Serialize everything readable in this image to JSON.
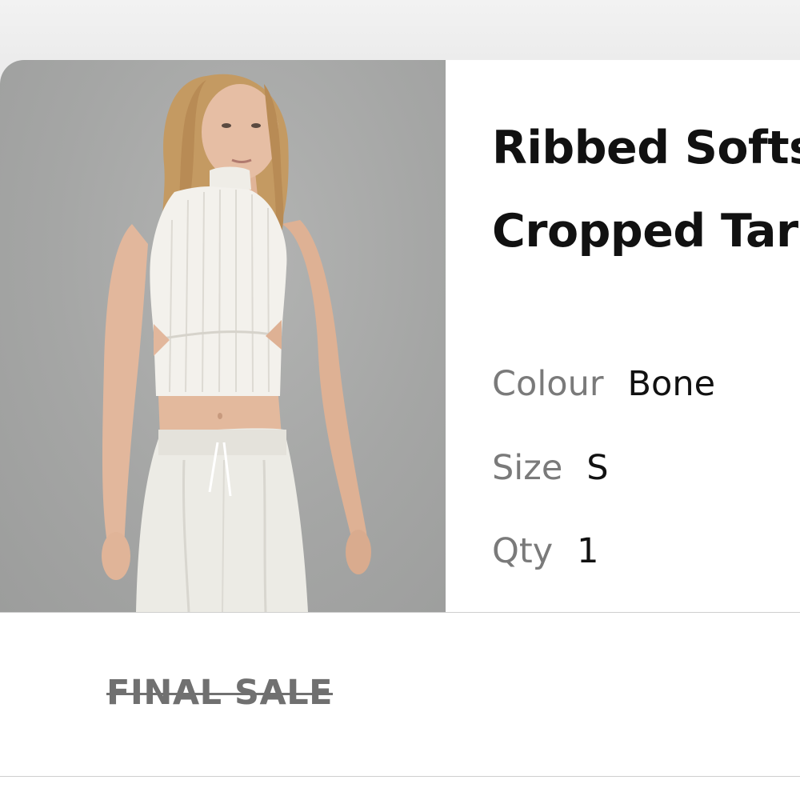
{
  "product": {
    "title_line1": "Ribbed Softs",
    "title_line2": "Cropped Tar",
    "image_alt": "Model wearing white ribbed cropped tank with cut-outs and white cargo pants",
    "attributes": {
      "colour_label": "Colour",
      "colour_value": "Bone",
      "size_label": "Size",
      "size_value": "S",
      "qty_label": "Qty",
      "qty_value": "1"
    }
  },
  "badges": {
    "final_sale": "FINAL SALE"
  },
  "colors": {
    "photo_background": "#a6a7a6",
    "title_text": "#111111",
    "label_text": "#7a7a7a",
    "final_sale_text": "#707070"
  }
}
